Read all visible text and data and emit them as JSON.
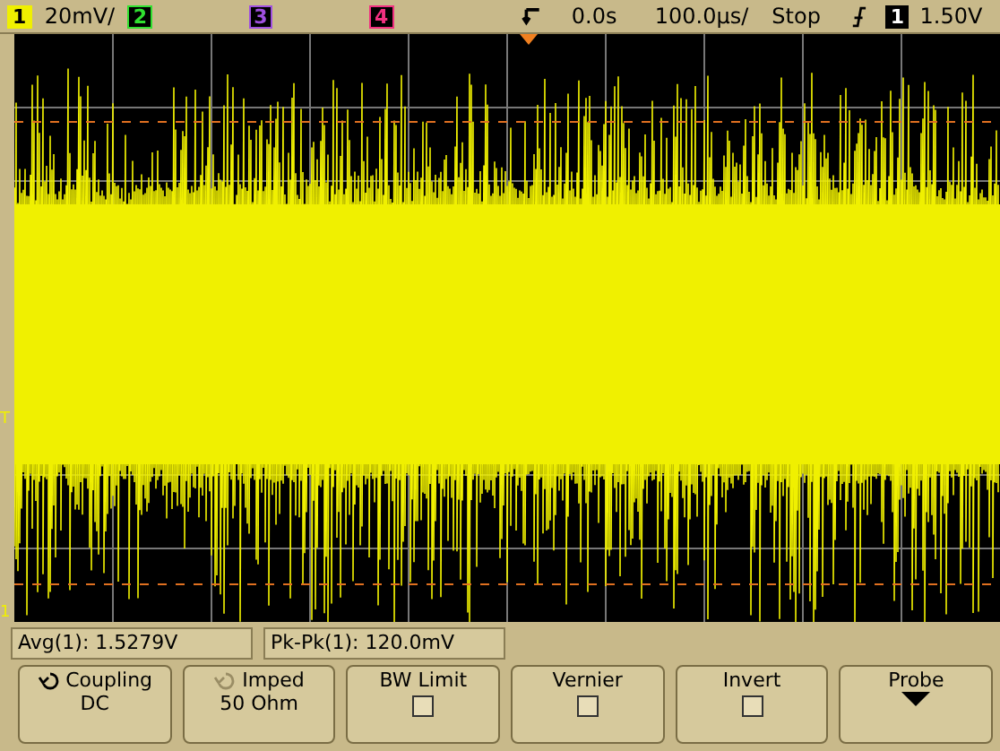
{
  "status_bar": {
    "channels": [
      {
        "label": "1",
        "on": true,
        "color": "#f0f000",
        "scale": "20mV/"
      },
      {
        "label": "2",
        "on": false,
        "color": "#30e030"
      },
      {
        "label": "3",
        "on": false,
        "color": "#a050e0"
      },
      {
        "label": "4",
        "on": false,
        "color": "#f03080"
      }
    ],
    "delay": "0.0s",
    "timebase": "100.0µs/",
    "run_state": "Stop",
    "trigger_source": "1",
    "trigger_level": "1.50V"
  },
  "display": {
    "trace_marker": "1",
    "trigger_marker": "T"
  },
  "measurements": [
    "Avg(1): 1.5279V",
    "Pk-Pk(1): 120.0mV"
  ],
  "softkeys": [
    {
      "kind": "value",
      "label": "Coupling",
      "value": "DC",
      "disabled": false
    },
    {
      "kind": "value",
      "label": "Imped",
      "value": "50 Ohm",
      "disabled": true
    },
    {
      "kind": "checkbox",
      "label": "BW Limit",
      "checked": false
    },
    {
      "kind": "checkbox",
      "label": "Vernier",
      "checked": false
    },
    {
      "kind": "checkbox",
      "label": "Invert",
      "checked": false
    },
    {
      "kind": "menu",
      "label": "Probe"
    }
  ]
}
